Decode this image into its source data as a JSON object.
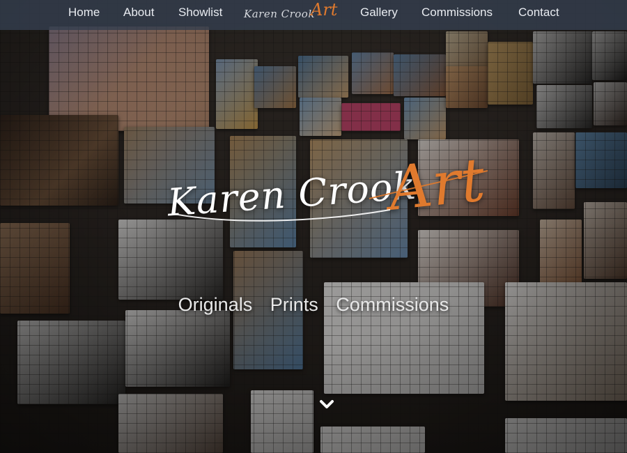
{
  "nav": {
    "items": [
      {
        "label": "Home"
      },
      {
        "label": "About"
      },
      {
        "label": "Showlist"
      },
      {
        "label": "Gallery"
      },
      {
        "label": "Commissions"
      },
      {
        "label": "Contact"
      }
    ],
    "logo": {
      "script": "Karen Crook",
      "accent": "Art"
    }
  },
  "hero": {
    "logo": {
      "script": "Karen Crook",
      "accent": "Art"
    },
    "tagline": [
      "Originals",
      "Prints",
      "Commissions"
    ],
    "scroll_icon": "chevron-down-icon"
  },
  "colors": {
    "nav_bg": "#343e4e",
    "accent": "#e07a2e",
    "text": "#ffffff"
  }
}
